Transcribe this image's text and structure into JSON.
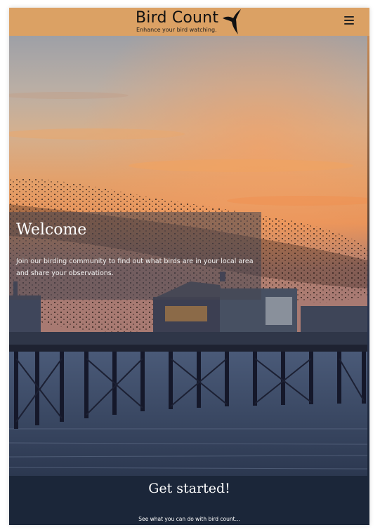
{
  "header": {
    "title": "Bird Count",
    "tagline": "Enhance your bird watching.",
    "menu_icon": "hamburger-menu-icon",
    "background_color": "#dba164"
  },
  "hero": {
    "image": "starlings-over-pier-at-sunset",
    "welcome_title": "Welcome",
    "welcome_text": "Join our birding community to find out what birds are in your local area and share your observations."
  },
  "footer": {
    "heading": "Get started!",
    "subtext": "See what you can do with bird count...",
    "background_color": "#1b2639"
  }
}
